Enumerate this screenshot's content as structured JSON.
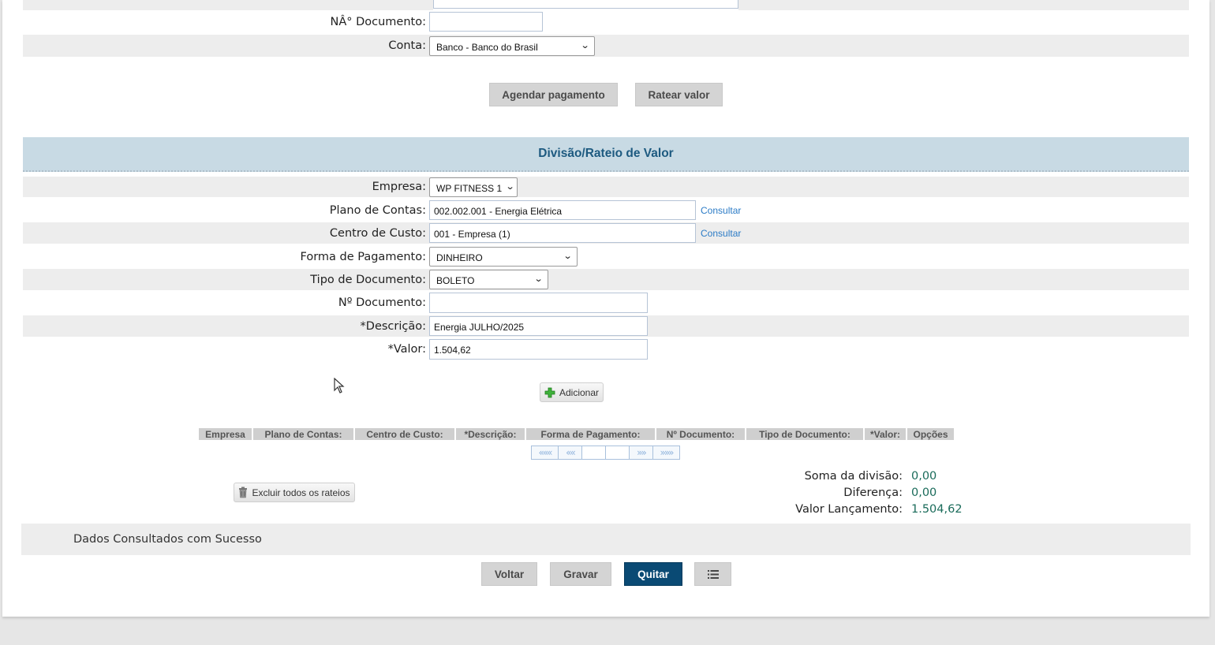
{
  "top_form": {
    "documento_label": "NÂ° Documento:",
    "documento_value": "",
    "conta_label": "Conta:",
    "conta_value": "Banco - Banco do Brasil"
  },
  "top_buttons": {
    "agendar": "Agendar pagamento",
    "ratear": "Ratear valor"
  },
  "section": {
    "title": "Divisão/Rateio de Valor"
  },
  "rateio_form": {
    "empresa_label": "Empresa:",
    "empresa_value": "WP FITNESS 1",
    "plano_label": "Plano de Contas:",
    "plano_value": "002.002.001 - Energia Elétrica",
    "centro_label": "Centro de Custo:",
    "centro_value": "001 - Empresa (1)",
    "consultar_label": "Consultar",
    "forma_label": "Forma de Pagamento:",
    "forma_value": "DINHEIRO",
    "tipo_label": "Tipo de Documento:",
    "tipo_value": "BOLETO",
    "ndoc_label": "Nº Documento:",
    "ndoc_value": "",
    "descricao_label": "*Descrição:",
    "descricao_value": "Energia JULHO/2025",
    "valor_label": "*Valor:",
    "valor_value": "1.504,62",
    "adicionar_label": "Adicionar"
  },
  "table": {
    "headers": [
      "Empresa",
      "Plano de Contas:",
      "Centro de Custo:",
      "*Descrição:",
      "Forma de Pagamento:",
      "Nº Documento:",
      "Tipo de Documento:",
      "*Valor:",
      "Opções"
    ]
  },
  "pager": {
    "first": "«««",
    "prev": "««",
    "next": "»»",
    "last": "»»»"
  },
  "summary": {
    "soma_label": "Soma da divisão:",
    "soma_value": "0,00",
    "diferenca_label": "Diferença:",
    "diferenca_value": "0,00",
    "valor_label": "Valor Lançamento:",
    "valor_value": "1.504,62"
  },
  "excluir_label": "Excluir todos os rateios",
  "status_message": "Dados Consultados com Sucesso",
  "bottom_buttons": {
    "voltar": "Voltar",
    "gravar": "Gravar",
    "quitar": "Quitar",
    "list_icon": "list-icon"
  },
  "colors": {
    "primary": "#0a4a74",
    "section_bg": "#c8dae4",
    "section_text": "#1d5a80",
    "link": "#2b7bc6",
    "summary_value": "#1a6b5a"
  }
}
